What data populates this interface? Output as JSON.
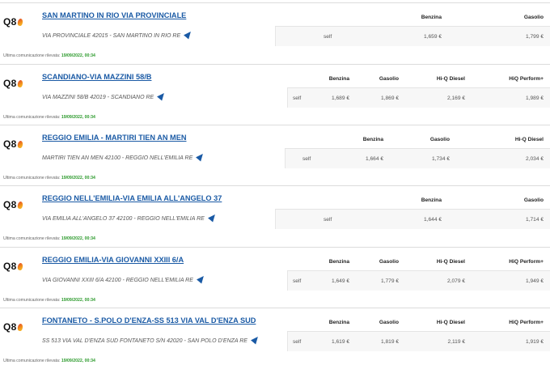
{
  "last_update_label": "Ultima comunicazione rilevata:",
  "stations": [
    {
      "brand": "Q8",
      "name": "SAN MARTINO IN RIO VIA PROVINCIALE",
      "address": "VIA PROVINCIALE 42015 - SAN MARTINO IN RIO RE",
      "last_update": "19/09/2022, 00:34",
      "mode": "self",
      "columns": [
        "Benzina",
        "Gasolio"
      ],
      "prices": [
        "1,659 €",
        "1,799 €"
      ]
    },
    {
      "brand": "Q8",
      "name": "SCANDIANO-VIA MAZZINI 58/B",
      "address": "VIA MAZZINI 58/B 42019 - SCANDIANO RE",
      "last_update": "19/09/2022, 00:34",
      "mode": "self",
      "columns": [
        "Benzina",
        "Gasolio",
        "Hi-Q Diesel",
        "HiQ Perform+"
      ],
      "prices": [
        "1,689 €",
        "1,869 €",
        "2,169 €",
        "1,989 €"
      ]
    },
    {
      "brand": "Q8",
      "name": "REGGIO EMILIA - MARTIRI TIEN AN MEN",
      "address": "MARTIRI TIEN AN MEN 42100 - REGGIO NELL'EMILIA RE",
      "last_update": "19/09/2022, 00:34",
      "mode": "self",
      "columns": [
        "Benzina",
        "Gasolio",
        "Hi-Q Diesel"
      ],
      "prices": [
        "1,664 €",
        "1,734 €",
        "2,034 €"
      ]
    },
    {
      "brand": "Q8",
      "name": "REGGIO NELL'EMILIA-VIA EMILIA ALL'ANGELO 37",
      "address": "VIA EMILIA ALL'ANGELO 37 42100 - REGGIO NELL'EMILIA RE",
      "last_update": "19/09/2022, 00:34",
      "mode": "self",
      "columns": [
        "Benzina",
        "Gasolio"
      ],
      "prices": [
        "1,644 €",
        "1,714 €"
      ]
    },
    {
      "brand": "Q8",
      "name": "REGGIO EMILIA-VIA GIOVANNI XXIII 6/A",
      "address": "VIA GIOVANNI XXIII 6/A 42100 - REGGIO NELL'EMILIA RE",
      "last_update": "19/09/2022, 00:34",
      "mode": "self",
      "columns": [
        "Benzina",
        "Gasolio",
        "Hi-Q Diesel",
        "HiQ Perform+"
      ],
      "prices": [
        "1,649 €",
        "1,779 €",
        "2,079 €",
        "1,949 €"
      ]
    },
    {
      "brand": "Q8",
      "name": "FONTANETO - S.POLO D'ENZA-SS 513 VIA VAL D'ENZA SUD",
      "address": "SS 513 VIA VAL D'ENZA SUD FONTANETO S/N 42020 - SAN POLO D'ENZA RE",
      "last_update": "19/09/2022, 00:34",
      "mode": "self",
      "columns": [
        "Benzina",
        "Gasolio",
        "Hi-Q Diesel",
        "HiQ Perform+"
      ],
      "prices": [
        "1,619 €",
        "1,819 €",
        "2,119 €",
        "1,919 €"
      ]
    }
  ]
}
